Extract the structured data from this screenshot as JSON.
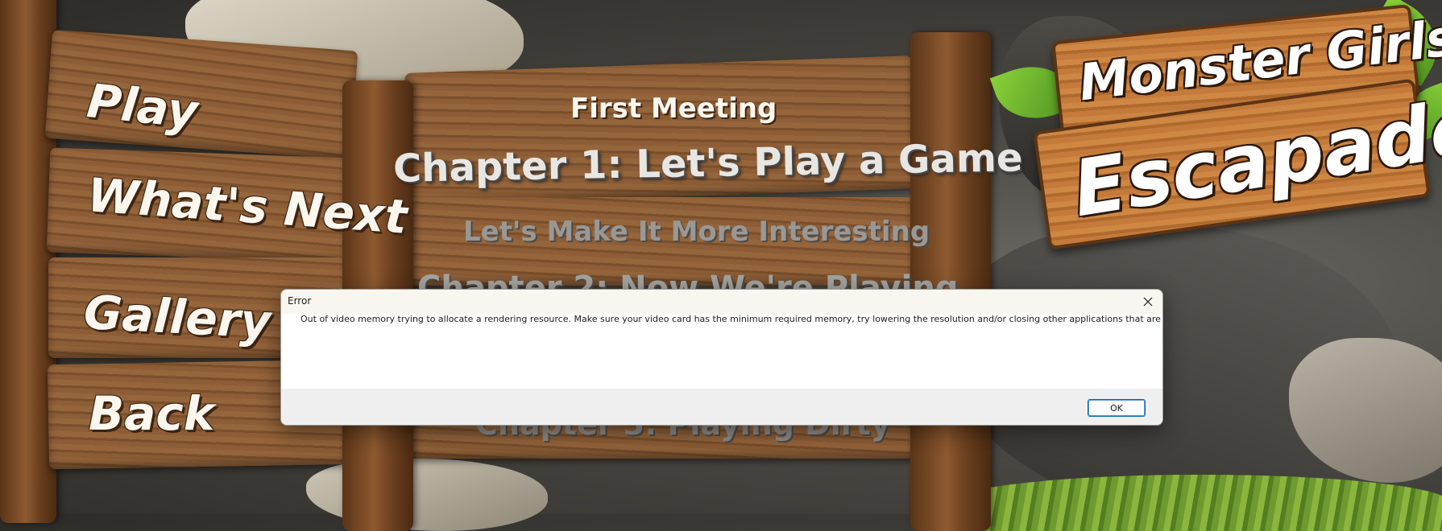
{
  "game": {
    "logo_line1": "Monster Girls",
    "logo_line2": "Escapade"
  },
  "menu": {
    "items": [
      {
        "label": "Play"
      },
      {
        "label": "What's Next"
      },
      {
        "label": "Gallery"
      },
      {
        "label": "Back"
      }
    ]
  },
  "chapters": {
    "heading": "First Meeting",
    "items": [
      {
        "label": "Chapter 1: Let's Play a Game"
      },
      {
        "label": "Let's Make It More Interesting"
      },
      {
        "label": "Chapter 2: Now We're Playing"
      },
      {
        "label": "Chapter 3: Playing Dirty"
      }
    ]
  },
  "dialog": {
    "title": "Error",
    "message": "Out of video memory trying to allocate a rendering resource. Make sure your video card has the minimum required memory, try lowering the resolution and/or closing other applications that are running. Exiting...",
    "ok_label": "OK",
    "close_icon": "close-icon"
  }
}
